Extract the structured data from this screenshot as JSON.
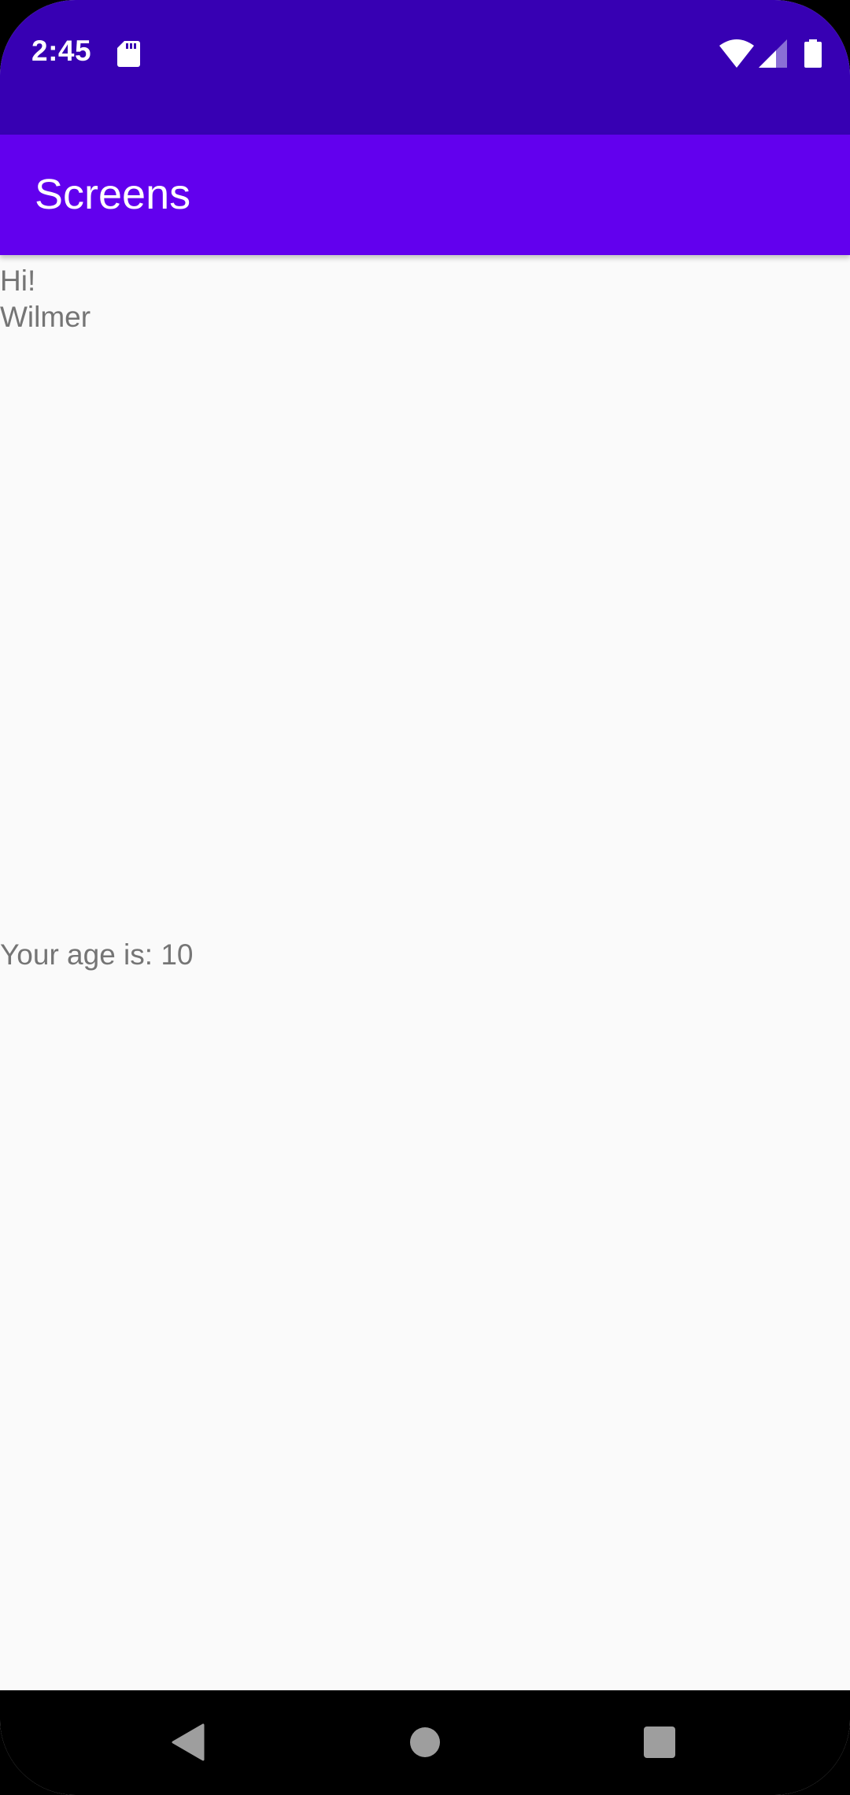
{
  "status_bar": {
    "time": "2:45",
    "icons": [
      "sd-card-icon",
      "wifi-icon",
      "signal-icon",
      "battery-icon"
    ],
    "background": "#3700b3"
  },
  "app_bar": {
    "title": "Screens",
    "background": "#6200ee"
  },
  "content": {
    "greeting": "Hi!",
    "name": "Wilmer",
    "age_text": "Your age is: 10",
    "text_color": "#757575",
    "background": "#fafafa"
  },
  "nav_bar": {
    "buttons": [
      "back-icon",
      "home-icon",
      "recents-icon"
    ]
  }
}
